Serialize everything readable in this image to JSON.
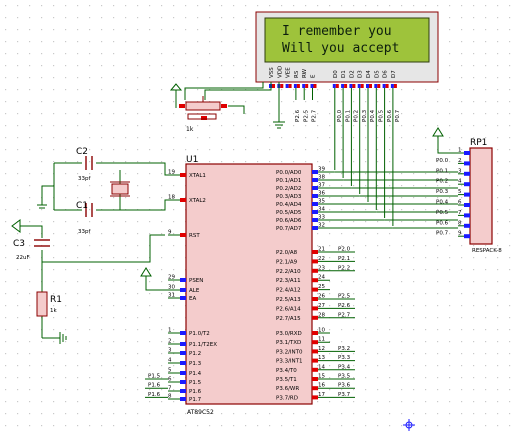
{
  "colors": {
    "background": "#ffffff",
    "grid_dot": "#c9c9c9",
    "wire_green": "#006000",
    "body_red": "#8b0000",
    "body_fill": "#f4cccc",
    "lcd_screen": "#9ec33b",
    "pin_blue": "#1a1aff",
    "pin_red": "#e00000",
    "text": "#000000"
  },
  "lcd": {
    "line1": "I remember you",
    "line2": "Will you accept",
    "pins": [
      "VSS",
      "VDD",
      "VEE",
      "RS",
      "RW",
      "E",
      "D0",
      "D1",
      "D2",
      "D3",
      "D4",
      "D5",
      "D6",
      "D7"
    ]
  },
  "pot": {
    "value": "1k"
  },
  "u1": {
    "ref": "U1",
    "part": "AT89C52",
    "left_pins": [
      {
        "num": "19",
        "name": "XTAL1"
      },
      {
        "num": "18",
        "name": "XTAL2"
      },
      {
        "num": "9",
        "name": "RST"
      },
      {
        "num": "29",
        "name": "PSEN"
      },
      {
        "num": "30",
        "name": "ALE"
      },
      {
        "num": "31",
        "name": "EA"
      },
      {
        "num": "1",
        "name": "P1.0/T2"
      },
      {
        "num": "2",
        "name": "P1.1/T2EX"
      },
      {
        "num": "3",
        "name": "P1.2"
      },
      {
        "num": "4",
        "name": "P1.3"
      },
      {
        "num": "5",
        "name": "P1.4"
      },
      {
        "num": "6",
        "name": "P1.5"
      },
      {
        "num": "7",
        "name": "P1.6"
      },
      {
        "num": "8",
        "name": "P1.7"
      }
    ],
    "right_pins": [
      {
        "num": "39",
        "name": "P0.0/AD0"
      },
      {
        "num": "38",
        "name": "P0.1/AD1"
      },
      {
        "num": "37",
        "name": "P0.2/AD2"
      },
      {
        "num": "36",
        "name": "P0.3/AD3"
      },
      {
        "num": "35",
        "name": "P0.4/AD4"
      },
      {
        "num": "34",
        "name": "P0.5/AD5"
      },
      {
        "num": "33",
        "name": "P0.6/AD6"
      },
      {
        "num": "32",
        "name": "P0.7/AD7"
      },
      {
        "num": "21",
        "name": "P2.0/A8"
      },
      {
        "num": "22",
        "name": "P2.1/A9"
      },
      {
        "num": "23",
        "name": "P2.2/A10"
      },
      {
        "num": "24",
        "name": "P2.3/A11"
      },
      {
        "num": "25",
        "name": "P2.4/A12"
      },
      {
        "num": "26",
        "name": "P2.5/A13"
      },
      {
        "num": "27",
        "name": "P2.6/A14"
      },
      {
        "num": "28",
        "name": "P2.7/A15"
      },
      {
        "num": "10",
        "name": "P3.0/RXD"
      },
      {
        "num": "11",
        "name": "P3.1/TXD"
      },
      {
        "num": "12",
        "name": "P3.2/INT0"
      },
      {
        "num": "13",
        "name": "P3.3/INT1"
      },
      {
        "num": "14",
        "name": "P3.4/T0"
      },
      {
        "num": "15",
        "name": "P3.5/T1"
      },
      {
        "num": "16",
        "name": "P3.6/WR"
      },
      {
        "num": "17",
        "name": "P3.7/RD"
      }
    ],
    "p2_net_labels": [
      {
        "pin": 0,
        "text": "P2.0"
      },
      {
        "pin": 1,
        "text": "P2.1"
      },
      {
        "pin": 2,
        "text": "P2.2"
      },
      {
        "pin": 5,
        "text": "P2.5"
      },
      {
        "pin": 6,
        "text": "P2.6"
      },
      {
        "pin": 7,
        "text": "P2.7"
      }
    ],
    "p3_net_labels": [
      {
        "pin": 2,
        "text": "P3.2"
      },
      {
        "pin": 3,
        "text": "P3.3"
      },
      {
        "pin": 4,
        "text": "P3.4"
      },
      {
        "pin": 5,
        "text": "P3.5"
      },
      {
        "pin": 6,
        "text": "P3.6"
      },
      {
        "pin": 7,
        "text": "P3.7"
      }
    ],
    "p1_net_labels": [
      {
        "pin": 5,
        "text": "P1.5"
      },
      {
        "pin": 6,
        "text": "P1.6"
      },
      {
        "pin": 7,
        "text": "P1.6"
      }
    ]
  },
  "lcd_net_labels": [
    "P2.6",
    "P2.5",
    "P2.7",
    "P0.0",
    "P0.1",
    "P0.2",
    "P0.3",
    "P0.4",
    "P0.5",
    "P0.6",
    "P0.7"
  ],
  "rp1": {
    "ref": "RP1",
    "part": "RESPACK-8",
    "pins": [
      {
        "num": "1",
        "net": ""
      },
      {
        "num": "2",
        "net": "P0.0"
      },
      {
        "num": "3",
        "net": "P0.1"
      },
      {
        "num": "4",
        "net": "P0.2"
      },
      {
        "num": "5",
        "net": "P0.3"
      },
      {
        "num": "6",
        "net": "P0.4"
      },
      {
        "num": "7",
        "net": "P0.5"
      },
      {
        "num": "8",
        "net": "P0.6"
      },
      {
        "num": "9",
        "net": "P0.7"
      }
    ]
  },
  "c1": {
    "ref": "C1",
    "value": "33pf"
  },
  "c2": {
    "ref": "C2",
    "value": "33pf"
  },
  "c3": {
    "ref": "C3",
    "value": "22uF"
  },
  "r1": {
    "ref": "R1",
    "value": "1k"
  }
}
